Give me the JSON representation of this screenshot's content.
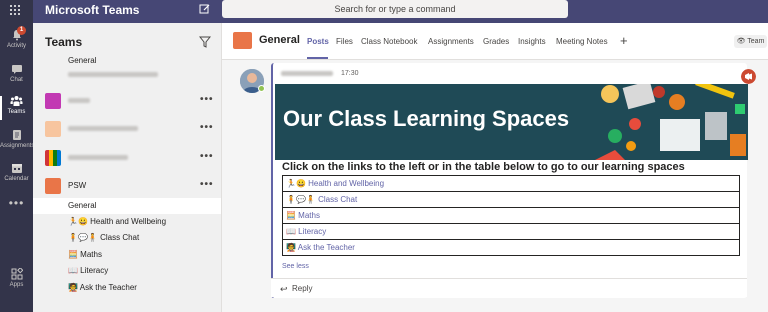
{
  "app": {
    "title": "Microsoft Teams",
    "search_placeholder": "Search for or type a command"
  },
  "rail": {
    "items": [
      {
        "label": "Activity",
        "badge": "1",
        "icon": "bell-icon"
      },
      {
        "label": "Chat",
        "icon": "chat-icon"
      },
      {
        "label": "Teams",
        "icon": "teams-icon"
      },
      {
        "label": "Assignments",
        "icon": "assignments-icon"
      },
      {
        "label": "Calendar",
        "icon": "calendar-icon"
      },
      {
        "label": "Apps",
        "icon": "apps-icon"
      }
    ]
  },
  "left": {
    "title": "Teams",
    "rows": [
      {
        "label": "General"
      },
      {
        "label": "PSW"
      },
      {
        "label": "General"
      },
      {
        "label": "🏃😀 Health and Wellbeing"
      },
      {
        "label": "🧍💬🧍 Class Chat"
      },
      {
        "label": "🧮 Maths"
      },
      {
        "label": "📖 Literacy"
      },
      {
        "label": "🧑‍🏫 Ask the Teacher"
      }
    ]
  },
  "channel": {
    "name": "General",
    "tabs": [
      "Posts",
      "Files",
      "Class Notebook",
      "Assignments",
      "Grades",
      "Insights",
      "Meeting Notes"
    ],
    "add_tab": "+",
    "team_button": "👁 Team"
  },
  "post": {
    "time": "17:30",
    "banner_title": "Our Class Learning Spaces",
    "body_heading": "Click on the links to the left or in the table below to go to our learning spaces",
    "links": [
      "🏃😀 Health and Wellbeing",
      "🧍💬🧍 Class Chat",
      "🧮 Maths",
      "📖 Literacy",
      "🧑‍🏫 Ask the Teacher"
    ],
    "see_less": "See less",
    "reply": "Reply"
  },
  "colors": {
    "brand": "#464775",
    "accent": "#6264a7",
    "rail": "#33344a",
    "banner": "#1f4a56"
  }
}
